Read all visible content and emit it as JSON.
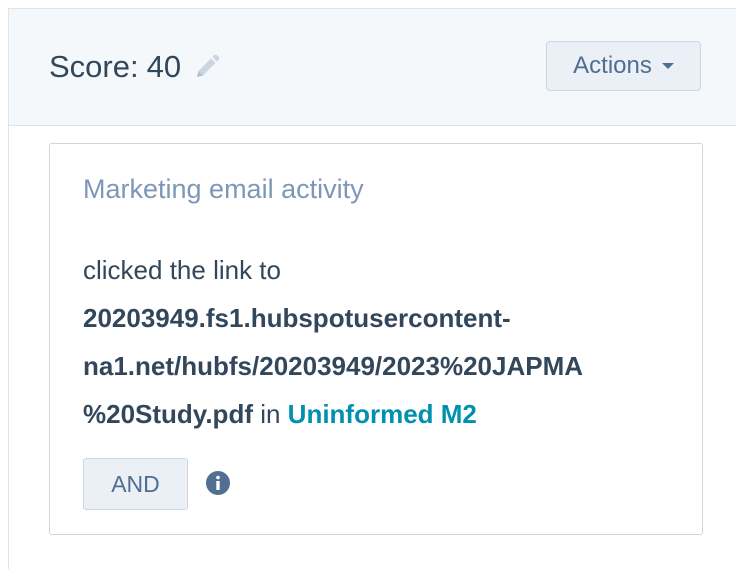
{
  "header": {
    "score_label": "Score:",
    "score_value": "40",
    "edit_icon": "pencil-icon",
    "actions_label": "Actions"
  },
  "card": {
    "title": "Marketing email activity",
    "prefix": "clicked the link to ",
    "link_url_line1": "20203949.fs1.hubspotusercontent-",
    "link_url_line2": "na1.net/hubfs/20203949/2023%20JAPMA",
    "link_url_line3": "%20Study.pdf",
    "in_word": " in ",
    "email_name": "Uninformed M2",
    "and_label": "AND",
    "info_icon": "info-icon"
  },
  "colors": {
    "header_bg": "#f5f8fa",
    "button_bg": "#eaf0f6",
    "link": "#0091ae",
    "muted": "#7c98b6",
    "text": "#33475b"
  }
}
